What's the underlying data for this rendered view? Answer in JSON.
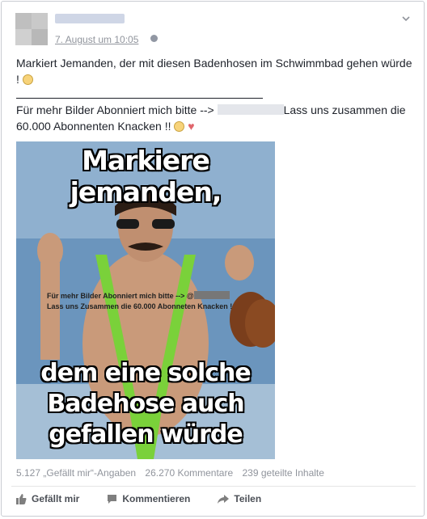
{
  "post": {
    "timestamp": "7. August um 10:05",
    "text_line1": "Markiert Jemanden, der mit diesen Badenhosen im Schwimmbad gehen würde !",
    "text_part2a": "Für mehr Bilder Abonniert mich bitte -->",
    "text_part2b": "Lass uns zusammen die 60.000 Abonnenten Knacken !!",
    "icons": {
      "avatar": "profile-avatar-icon",
      "privacy": "globe-icon",
      "menu": "chevron-down-icon"
    }
  },
  "image": {
    "top_caption": "Markiere jemanden,",
    "bottom_caption_1": "dem eine solche",
    "bottom_caption_2": "Badehose auch",
    "bottom_caption_3": "gefallen würde",
    "watermark_line1": "Für mehr Bilder Abonniert mich bitte --> @",
    "watermark_line2": "Lass uns Zusammen die 60.000 Abonneten Knacken !"
  },
  "stats": {
    "likes": "5.127 „Gefällt mir“-Angaben",
    "comments": "26.270 Kommentare",
    "shares": "239 geteilte Inhalte"
  },
  "actions": {
    "like": "Gefällt mir",
    "comment": "Kommentieren",
    "share": "Teilen"
  },
  "colors": {
    "text": "#1d2129",
    "meta": "#90949c",
    "border": "#c9ccd2"
  }
}
